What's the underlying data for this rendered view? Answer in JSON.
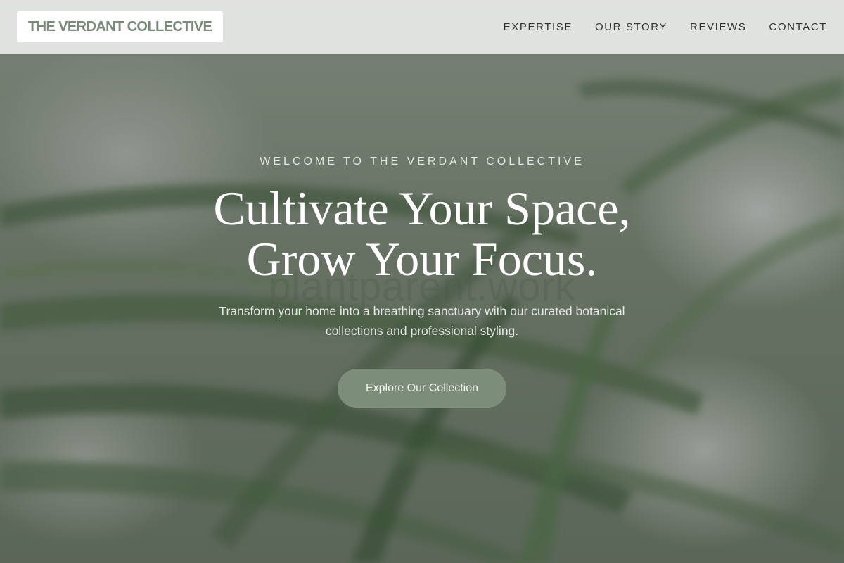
{
  "header": {
    "logo_text": "THE VERDANT COLLECTIVE",
    "nav": [
      {
        "label": "EXPERTISE"
      },
      {
        "label": "OUR STORY"
      },
      {
        "label": "REVIEWS"
      },
      {
        "label": "CONTACT"
      }
    ]
  },
  "hero": {
    "eyebrow": "WELCOME TO THE VERDANT COLLECTIVE",
    "headline_line1": "Cultivate Your Space,",
    "headline_line2": "Grow Your Focus.",
    "watermark": "plantparent.work",
    "subtitle": "Transform your home into a breathing sanctuary with our curated botanical collections and professional styling.",
    "cta_label": "Explore Our Collection"
  },
  "colors": {
    "accent": "#7c8e7a",
    "logo_text": "#7a8a78",
    "nav_text": "#2c3530",
    "header_bg": "#e8eae8"
  }
}
